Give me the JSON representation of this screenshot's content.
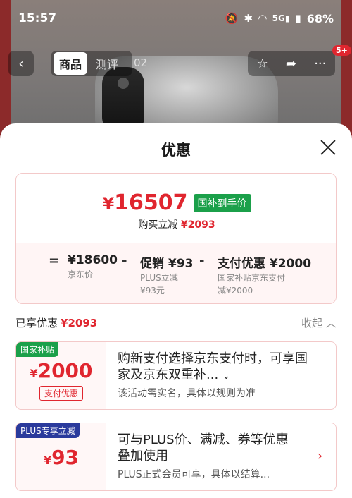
{
  "status_bar": {
    "time": "15:57",
    "network": "5G",
    "battery": "68%"
  },
  "nav": {
    "tab_product": "商品",
    "tab_review": "测评",
    "tab_extra": "02",
    "badge": "5+"
  },
  "sheet": {
    "title": "优惠"
  },
  "price": {
    "final_price": "16507",
    "yen": "¥",
    "tag": "国补到手价",
    "reduce_label": "购买立减",
    "reduce_value": "¥2093",
    "calc": {
      "equals": "=",
      "base_value": "¥18600",
      "base_caption": "京东价",
      "minus1": "-",
      "promo_value": "促销 ¥93",
      "promo_caption_1": "PLUS立减",
      "promo_caption_2": "¥93元",
      "minus2": "-",
      "pay_value": "支付优惠 ¥2000",
      "pay_caption_1": "国家补贴京东支付",
      "pay_caption_2": "减¥2000"
    }
  },
  "enjoyed": {
    "label": "已享优惠",
    "value": "¥2093",
    "collapse": "收起"
  },
  "promos": [
    {
      "flag": "国家补贴",
      "flag_color": "#1ba04a",
      "yen": "¥",
      "amount": "2000",
      "subtag": "支付优惠",
      "desc_line1": "购新支付选择京东支付时，可享国",
      "desc_line2": "家及京东双重补...",
      "note": "该活动需实名，具体以规则为准"
    },
    {
      "flag": "PLUS专享立减",
      "flag_color": "#2a3a9c",
      "yen": "¥",
      "amount": "93",
      "desc_line1": "可与PLUS价、满减、券等优惠",
      "desc_line2": "叠加使用",
      "note": "PLUS正式会员可享，具体以结算..."
    }
  ],
  "colors": {
    "accent_red": "#e0262f",
    "green": "#1ba04a",
    "plus_blue": "#2a3a9c"
  }
}
